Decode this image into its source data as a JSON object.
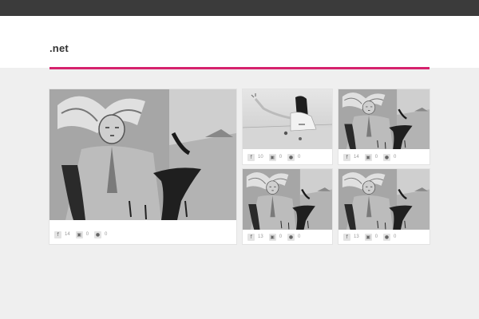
{
  "header": {
    "logo_text": ".net"
  },
  "colors": {
    "topbar": "#3b3b3b",
    "accent": "#d6226d",
    "page_bg": "#efefef",
    "card_bg": "#ffffff"
  },
  "icons": {
    "share": "facebook-icon",
    "views": "views-icon",
    "comments": "comment-icon"
  },
  "cards": [
    {
      "image": "angel-artwork",
      "share_count": "14",
      "view_count": "0",
      "comment_count": "0"
    },
    {
      "image": "girl-at-table-artwork",
      "share_count": "10",
      "view_count": "0",
      "comment_count": "0"
    },
    {
      "image": "angel-artwork",
      "share_count": "14",
      "view_count": "0",
      "comment_count": "0"
    },
    {
      "image": "angel-artwork",
      "share_count": "13",
      "view_count": "0",
      "comment_count": "0"
    },
    {
      "image": "angel-artwork",
      "share_count": "13",
      "view_count": "0",
      "comment_count": "0"
    }
  ]
}
